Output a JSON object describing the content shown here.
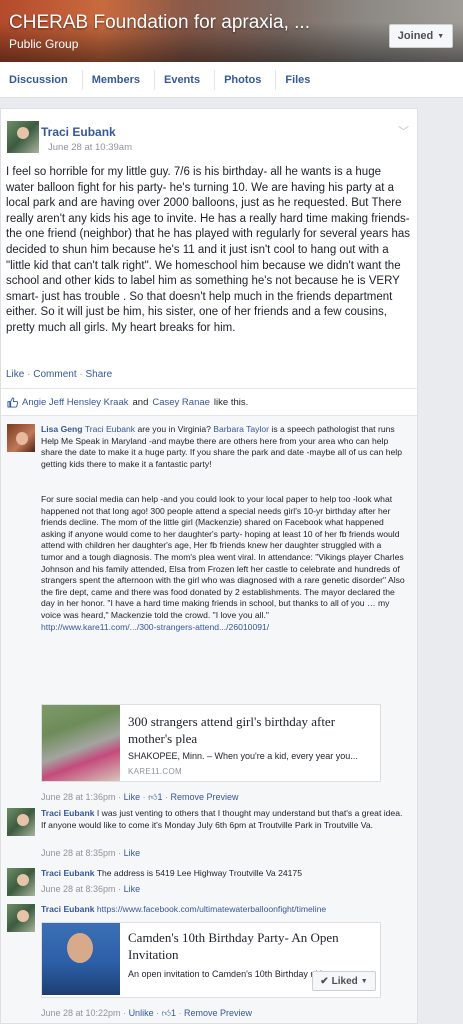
{
  "group": {
    "title": "CHERAB Foundation for apraxia, ...",
    "privacy": "Public Group",
    "joined_label": "Joined"
  },
  "tabs": [
    "Discussion",
    "Members",
    "Events",
    "Photos",
    "Files"
  ],
  "post": {
    "author": "Traci Eubank",
    "time": "June 28 at 10:39am",
    "text": "I feel so horrible for my little guy. 7/6 is his birthday- all he wants is a huge water balloon fight for his party- he's turning 10. We are having his party at a local park and are having over 2000 balloons, just as he requested. But There really aren't any kids his age to invite. He has a really hard time making friends- the one friend (neighbor) that he has played with regularly for several years has decided to shun him because he's 11 and it just isn't cool to hang out with a \"little kid that can't talk right\". We homeschool him because we didn't want the school and other kids to label him as something he's not because he is VERY smart- just has trouble . So that doesn't help much in the friends department either. So it will just be him, his sister, one of her friends and a few cousins, pretty much all girls. My heart breaks for him.",
    "actions": [
      "Like",
      "Comment",
      "Share"
    ],
    "likes": {
      "names": "Angie Jeff Hensley Kraak",
      "and_word": "and",
      "name2": "Casey Ranae",
      "suffix": "like this."
    }
  },
  "comments": [
    {
      "author": "Lisa Geng",
      "mention1": "Traci Eubank",
      "text1a": "are you in Virginia?",
      "mention2": "Barbara Taylor",
      "text1b": "is a speech pathologist that runs Help Me Speak in Maryland -and maybe there are others here from your area who can help share the date to make it a huge party. If you share the park and date -maybe all of us can help getting kids there to make it a fantastic party!",
      "text2": "For sure social media can help -and you could look to your local paper to help too -look what happened not that long ago! 300 people attend a special needs girl's 10-yr birthday after her friends decline. The mom of the little girl (Mackenzie) shared on Facebook what happened asking if anyone would come to her daughter's party- hoping at least 10 of her fb friends would attend with children her daughter's age, Her fb friends knew her daughter struggled with a tumor and a tough diagnosis. The mom's plea went viral. In attendance: \"Vikings player Charles Johnson and his family attended, Elsa from Frozen left her castle to celebrate and hundreds of strangers spent the afternoon with the girl who was diagnosed with a rare genetic disorder\" Also the fire dept, came and there was food donated by 2 establishments. The mayor declared the day in her honor. \"I have a hard time making friends in school, but thanks to all of you … my voice was heard,\" Mackenzie told the crowd. \"I love you all.\"",
      "link": "http://www.kare11.com/.../300-strangers-attend.../26010091/",
      "preview": {
        "title": "300 strangers attend girl's birthday after mother's plea",
        "desc": "SHAKOPEE, Minn. – When you're a kid, every year you...",
        "domain": "KARE11.COM"
      },
      "time": "June 28 at 1:36pm",
      "like": "Like",
      "like_count": "1",
      "remove": "Remove Preview"
    },
    {
      "author": "Traci Eubank",
      "text": "I was just venting to others that I thought may understand but that's a great idea. If anyone would like to come it's Monday July 6th 6pm at Troutville Park in Troutville Va.",
      "time": "June 28 at 8:35pm",
      "like": "Like"
    },
    {
      "author": "Traci Eubank",
      "text": "The address is 5419 Lee Highway Troutville Va 24175",
      "time": "June 28 at 8:36pm",
      "like": "Like"
    },
    {
      "author": "Traci Eubank",
      "link": "https://www.facebook.com/ultimatewaterballoonfight/timeline",
      "preview": {
        "title": "Camden's 10th Birthday Party- An Open Invitation",
        "desc": "An open invitation to Camden's 10th Birthday ultimate...",
        "liked_label": "Liked"
      },
      "time": "June 28 at 10:22pm",
      "unlike": "Unlike",
      "like_count": "1",
      "remove": "Remove Preview"
    }
  ]
}
